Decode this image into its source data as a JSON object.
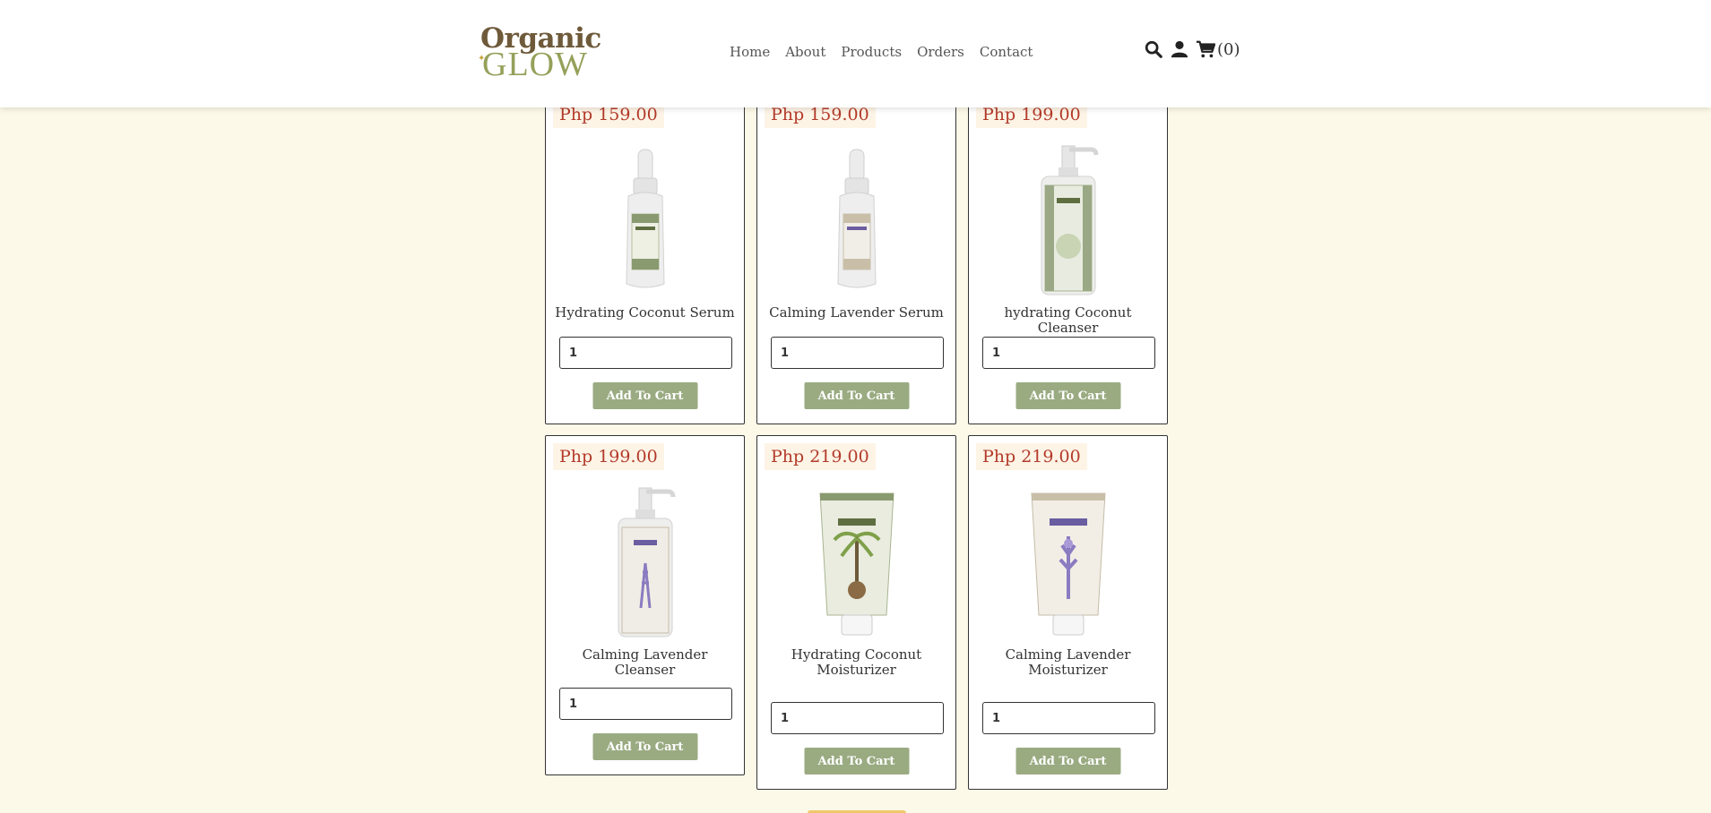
{
  "brand": {
    "line1": "Organic",
    "line2": "GLOW"
  },
  "nav": [
    "Home",
    "About",
    "Products",
    "Orders",
    "Contact"
  ],
  "header_icons": [
    "search-icon",
    "user-icon",
    "cart-icon"
  ],
  "cart": {
    "count": "(0)"
  },
  "products": [
    {
      "price": "Php 159.00",
      "name": "Hydrating Coconut Serum",
      "qty": "1",
      "button": "Add To Cart",
      "image": "serum-coconut"
    },
    {
      "price": "Php 159.00",
      "name": "Calming Lavender Serum",
      "qty": "1",
      "button": "Add To Cart",
      "image": "serum-lavender"
    },
    {
      "price": "Php 199.00",
      "name": "hydrating Coconut Cleanser",
      "qty": "1",
      "button": "Add To Cart",
      "image": "cleanser-coconut"
    },
    {
      "price": "Php 199.00",
      "name": "Calming Lavender Cleanser",
      "qty": "1",
      "button": "Add To Cart",
      "image": "cleanser-lavender"
    },
    {
      "price": "Php 219.00",
      "name": "Hydrating Coconut Moisturizer",
      "qty": "1",
      "button": "Add To Cart",
      "image": "tube-coconut"
    },
    {
      "price": "Php 219.00",
      "name": "Calming Lavender Moisturizer",
      "qty": "1",
      "button": "Add To Cart",
      "image": "tube-lavender"
    }
  ],
  "colors": {
    "accent": "#9aab82",
    "price": "#b33a2a",
    "background": "#fdf9e9"
  }
}
